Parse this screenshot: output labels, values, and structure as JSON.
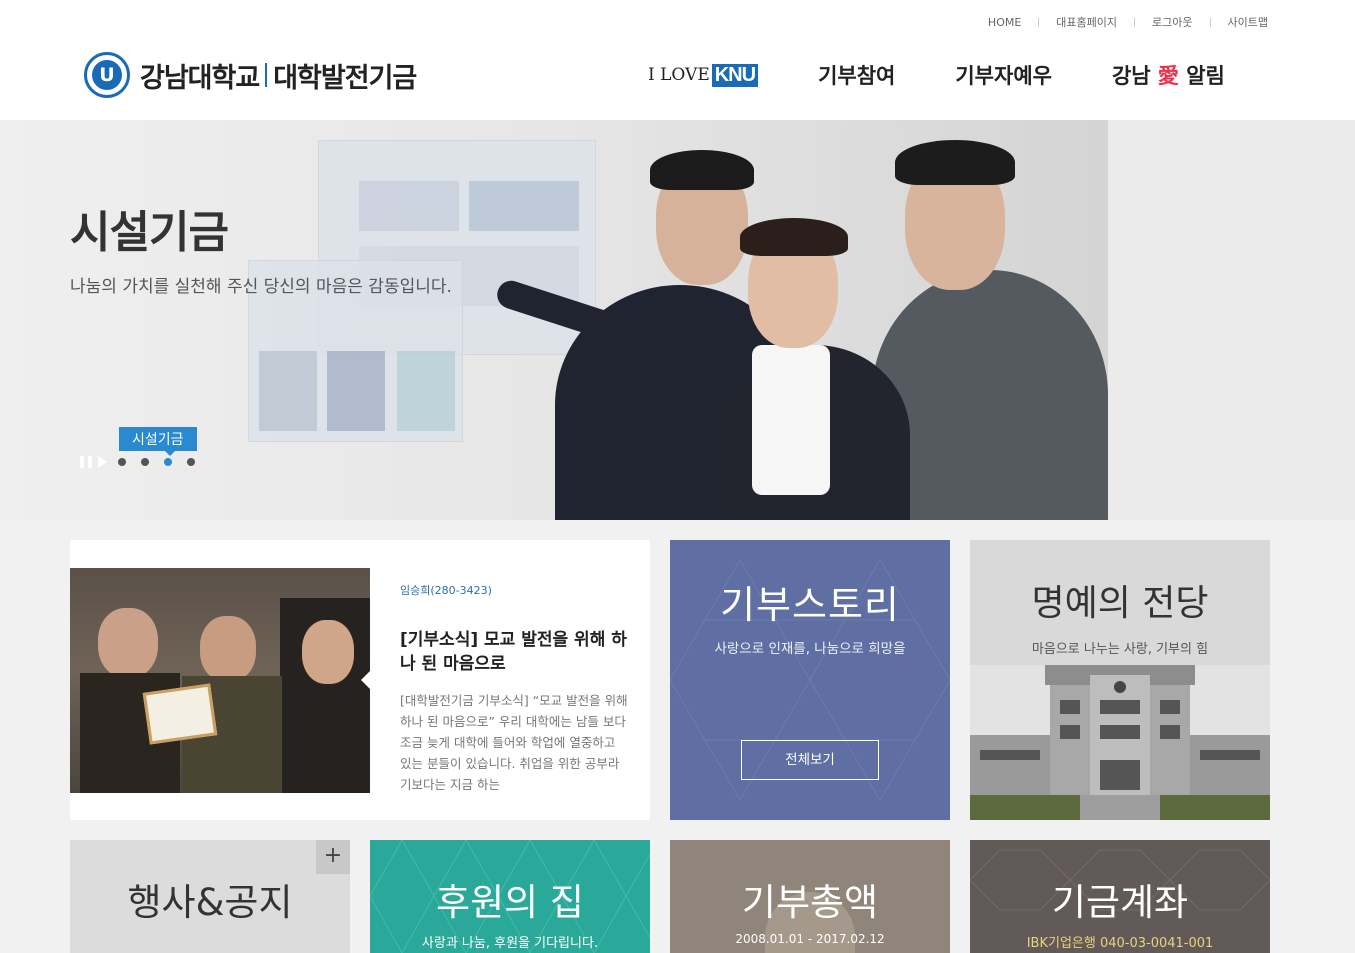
{
  "util_nav": [
    "HOME",
    "대표홈페이지",
    "로그아웃",
    "사이트맵"
  ],
  "logo": {
    "university": "강남대학교",
    "foundation": "대학발전기금",
    "seal_letter": "U"
  },
  "gnb": {
    "ilove_prefix": "I LOVE",
    "ilove_brand": "KNU",
    "items": [
      "기부참여",
      "기부자예우"
    ],
    "last_before": "강남",
    "last_heart": "愛",
    "last_after": "알림"
  },
  "hero": {
    "title": "시설기금",
    "subtitle": "나눔의 가치를 실천해 주신 당신의 마음은 감동입니다.",
    "tag": "시설기금",
    "slide_count": 4,
    "active_slide": 3
  },
  "news": {
    "author": "임승희(280-3423)",
    "title": "[기부소식] 모교 발전을 위해 하나 된 마음으로",
    "body": "[대학발전기금 기부소식] “모교 발전을 위해 하나 된 마음으로” 우리 대학에는 남들 보다 조금 늦게 대학에 들어와 학업에 열중하고 있는 분들이 있습니다. 취업을 위한 공부라기보다는 지금 하는"
  },
  "story": {
    "title": "기부스토리",
    "subtitle": "사랑으로 인재를, 나눔으로 희망을",
    "button": "전체보기"
  },
  "hall": {
    "title": "명예의 전당",
    "subtitle": "마음으로 나누는 사랑, 기부의 힘"
  },
  "event": {
    "title": "행사&공지",
    "plus": "+"
  },
  "house": {
    "title": "후원의 집",
    "subtitle": "사랑과 나눔, 후원을 기다립니다."
  },
  "total": {
    "title": "기부총액",
    "subtitle": "2008.01.01 - 2017.02.12"
  },
  "account": {
    "title": "기금계좌",
    "subtitle": "IBK기업은행 040-03-0041-001"
  },
  "colors": {
    "brand": "#1b6ab5",
    "story": "#5f6fa3",
    "house": "#2aa99a",
    "total": "#8f857a",
    "account": "#625a58",
    "accent": "#2a8ad0"
  }
}
